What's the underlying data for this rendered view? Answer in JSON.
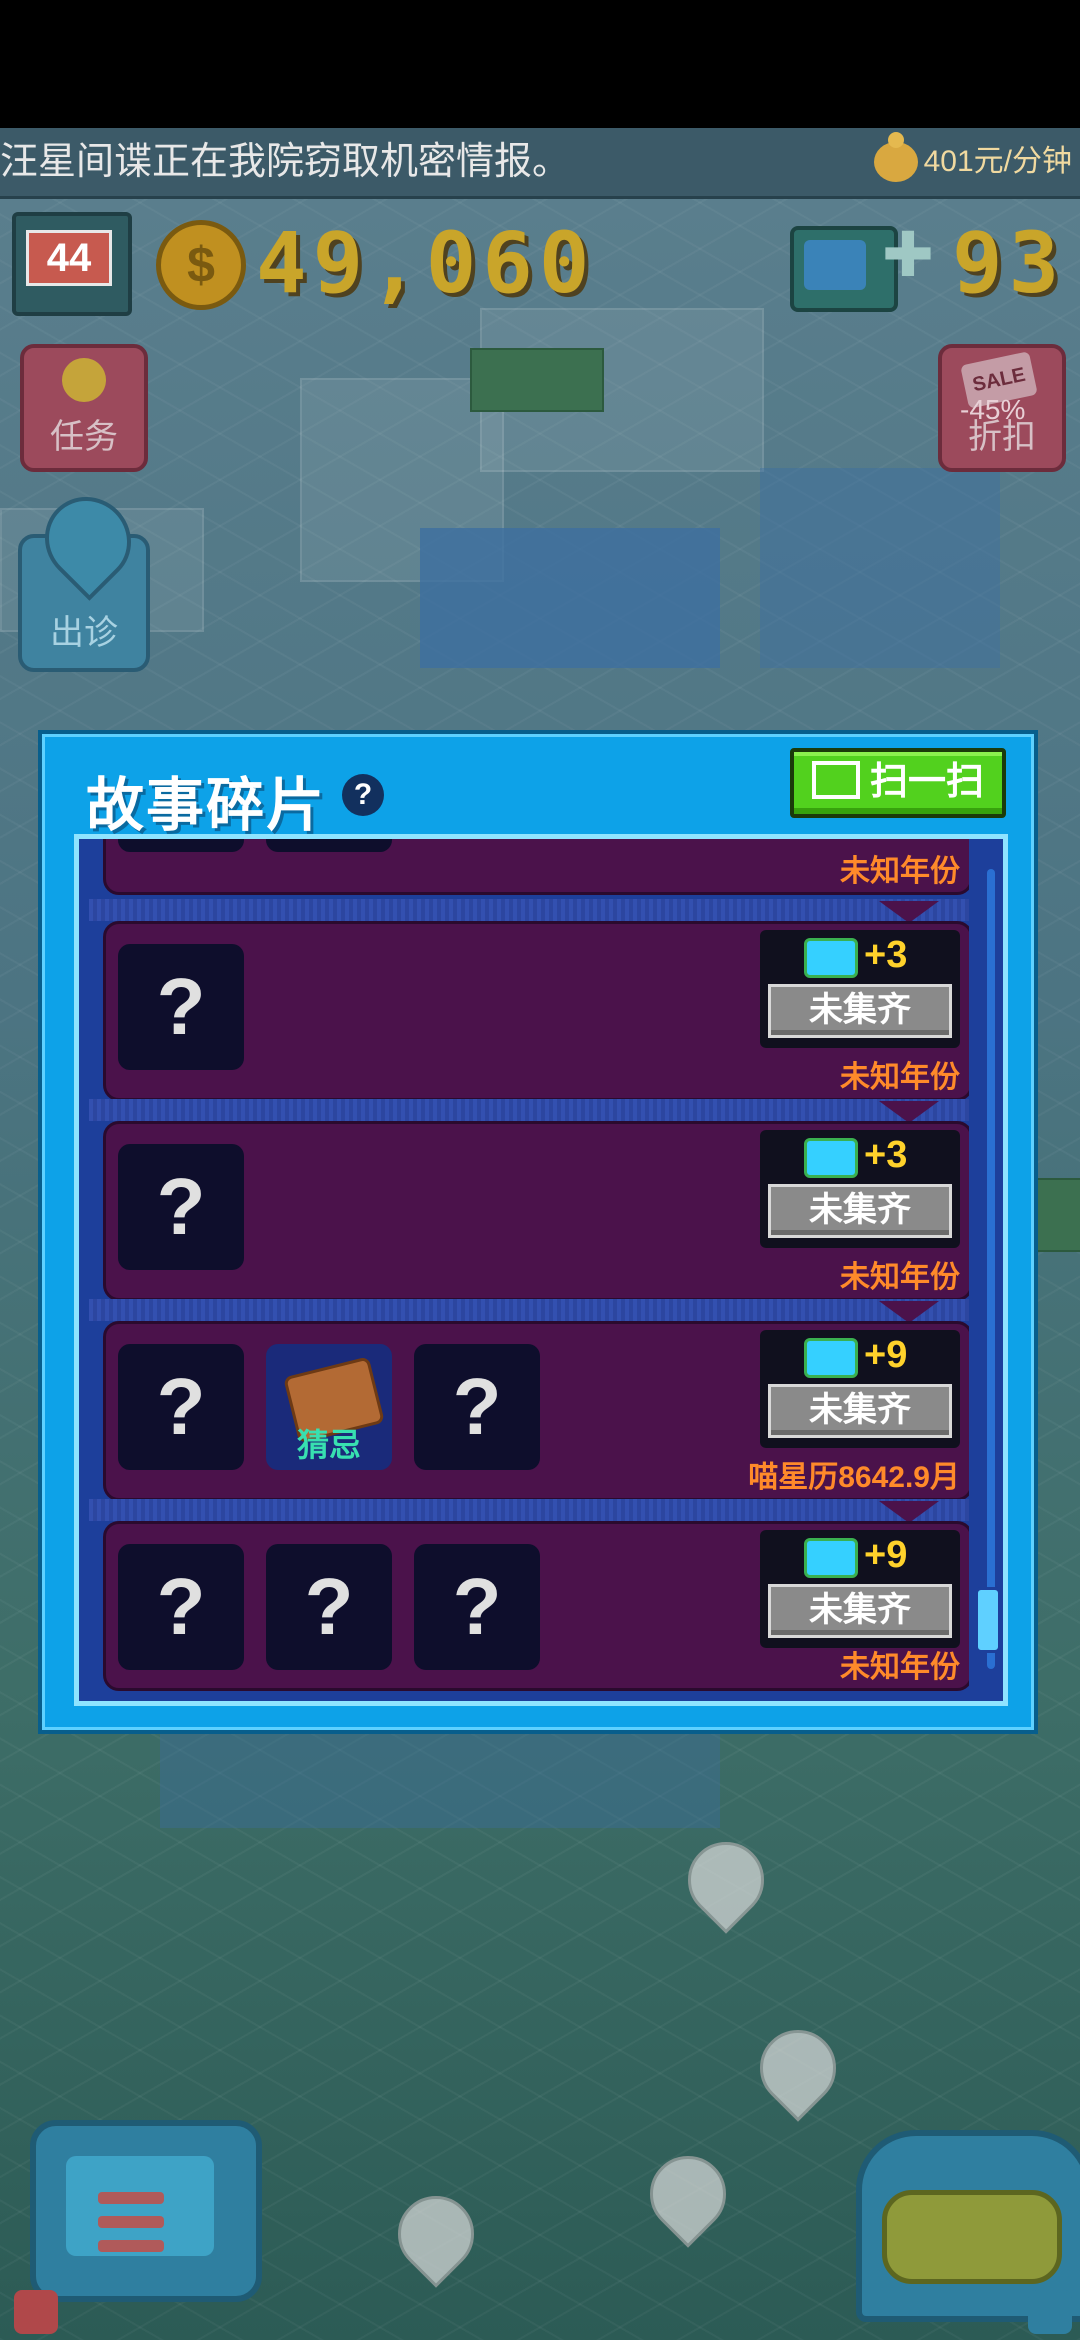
{
  "ticker": {
    "message": "汪星间谍正在我院窃取机密情报。",
    "rate": "401元/分钟"
  },
  "hud": {
    "level": "44",
    "money": "49,060",
    "fish": "93",
    "task_label": "任务",
    "sale_badge": "SALE",
    "sale_percent": "-45%",
    "sale_label": "折扣",
    "outing_label": "出诊"
  },
  "dialog": {
    "title": "故事碎片",
    "help": "?",
    "scan_label": "扫一扫"
  },
  "stories": [
    {
      "date": "未知年份",
      "reward": "+3",
      "status": "未集齐",
      "slots": [
        "?"
      ]
    },
    {
      "date": "未知年份",
      "reward": "+3",
      "status": "未集齐",
      "slots": [
        "?"
      ]
    },
    {
      "date": "喵星历8642.9月",
      "reward": "+9",
      "status": "未集齐",
      "slots": [
        "?",
        "猜忌",
        "?"
      ]
    },
    {
      "date": "未知年份",
      "reward": "+9",
      "status": "未集齐",
      "slots": [
        "?",
        "?",
        "?"
      ]
    }
  ],
  "top_partial": {
    "date": "未知年份"
  },
  "colors": {
    "dialog_bg": "#0da2e8",
    "card_bg": "#4b124b",
    "scan_button": "#52d11e",
    "reward_amount": "#ffd22b",
    "date_text": "#ff8a2a"
  }
}
